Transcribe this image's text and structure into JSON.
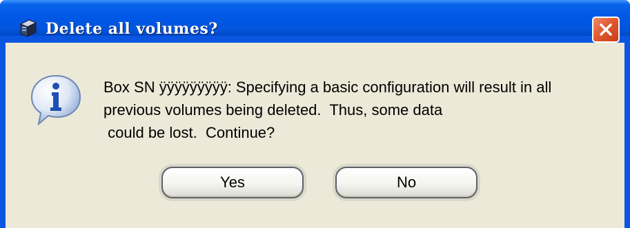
{
  "dialog": {
    "title": "Delete all volumes?",
    "message": "Box SN ÿÿÿÿÿÿÿÿÿ: Specifying a basic configuration will result in all\nprevious volumes being deleted.  Thus, some data\n could be lost.  Continue?",
    "icon": "info-icon",
    "buttons": {
      "yes_label": "Yes",
      "no_label": "No"
    }
  },
  "colors": {
    "titlebar": "#0058e6",
    "close": "#e25a31",
    "client": "#ece9d8"
  }
}
